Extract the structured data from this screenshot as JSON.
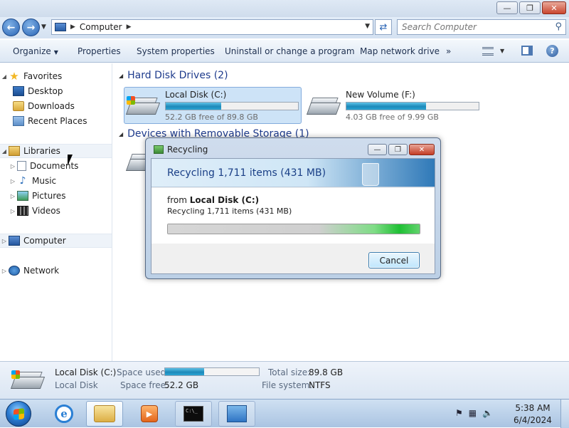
{
  "window": {
    "caption_buttons": [
      "minimize",
      "restore",
      "close"
    ]
  },
  "address": {
    "path": "Computer",
    "search_placeholder": "Search Computer"
  },
  "toolbar": {
    "organize": "Organize",
    "properties": "Properties",
    "system_properties": "System properties",
    "uninstall": "Uninstall or change a program",
    "map_drive": "Map network drive",
    "more": "»"
  },
  "nav": {
    "favorites": "Favorites",
    "desktop": "Desktop",
    "downloads": "Downloads",
    "recent_places": "Recent Places",
    "libraries": "Libraries",
    "documents": "Documents",
    "music": "Music",
    "pictures": "Pictures",
    "videos": "Videos",
    "computer": "Computer",
    "network": "Network"
  },
  "content": {
    "hdd_header": "Hard Disk Drives (2)",
    "removable_header": "Devices with Removable Storage (1)",
    "drives": [
      {
        "name": "Local Disk (C:)",
        "free_text": "52.2 GB free of 89.8 GB",
        "used_fraction": 0.42
      },
      {
        "name": "New Volume (F:)",
        "free_text": "4.03 GB free of 9.99 GB",
        "used_fraction": 0.6
      }
    ]
  },
  "dialog": {
    "title": "Recycling",
    "heading": "Recycling 1,711 items (431 MB)",
    "from_label": "from",
    "from_source": "Local Disk (C:)",
    "detail": "Recycling 1,711 items (431 MB)",
    "cancel": "Cancel",
    "progress_fraction": 1.0
  },
  "details": {
    "name": "Local Disk (C:)",
    "type": "Local Disk",
    "space_used_label": "Space used:",
    "space_used_fraction": 0.42,
    "space_free_label": "Space free:",
    "space_free": "52.2 GB",
    "total_size_label": "Total size:",
    "total_size": "89.8 GB",
    "file_system_label": "File system:",
    "file_system": "NTFS"
  },
  "taskbar": {
    "time": "5:38 AM",
    "date": "6/4/2024"
  },
  "colors": {
    "accent": "#1e3b8c",
    "drive_bar": "#1d89b9",
    "progress_green": "#1fc034"
  }
}
